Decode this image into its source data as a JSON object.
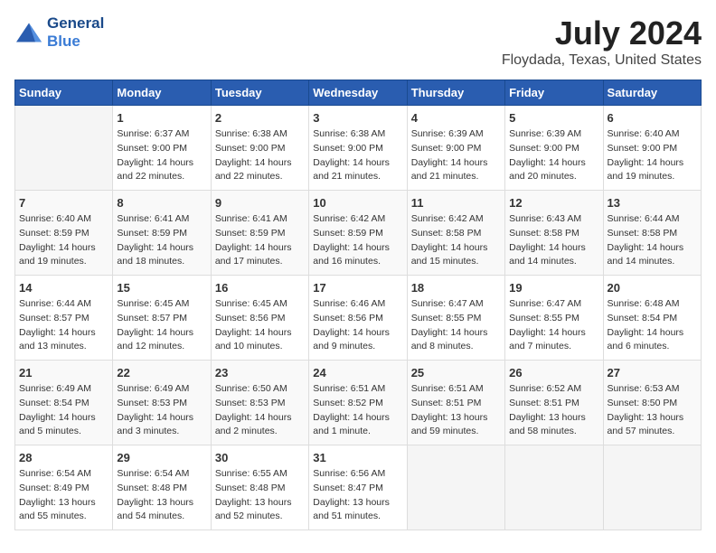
{
  "header": {
    "logo_line1": "General",
    "logo_line2": "Blue",
    "month_year": "July 2024",
    "location": "Floydada, Texas, United States"
  },
  "columns": [
    "Sunday",
    "Monday",
    "Tuesday",
    "Wednesday",
    "Thursday",
    "Friday",
    "Saturday"
  ],
  "weeks": [
    [
      {
        "day": "",
        "info": ""
      },
      {
        "day": "1",
        "info": "Sunrise: 6:37 AM\nSunset: 9:00 PM\nDaylight: 14 hours\nand 22 minutes."
      },
      {
        "day": "2",
        "info": "Sunrise: 6:38 AM\nSunset: 9:00 PM\nDaylight: 14 hours\nand 22 minutes."
      },
      {
        "day": "3",
        "info": "Sunrise: 6:38 AM\nSunset: 9:00 PM\nDaylight: 14 hours\nand 21 minutes."
      },
      {
        "day": "4",
        "info": "Sunrise: 6:39 AM\nSunset: 9:00 PM\nDaylight: 14 hours\nand 21 minutes."
      },
      {
        "day": "5",
        "info": "Sunrise: 6:39 AM\nSunset: 9:00 PM\nDaylight: 14 hours\nand 20 minutes."
      },
      {
        "day": "6",
        "info": "Sunrise: 6:40 AM\nSunset: 9:00 PM\nDaylight: 14 hours\nand 19 minutes."
      }
    ],
    [
      {
        "day": "7",
        "info": "Sunrise: 6:40 AM\nSunset: 8:59 PM\nDaylight: 14 hours\nand 19 minutes."
      },
      {
        "day": "8",
        "info": "Sunrise: 6:41 AM\nSunset: 8:59 PM\nDaylight: 14 hours\nand 18 minutes."
      },
      {
        "day": "9",
        "info": "Sunrise: 6:41 AM\nSunset: 8:59 PM\nDaylight: 14 hours\nand 17 minutes."
      },
      {
        "day": "10",
        "info": "Sunrise: 6:42 AM\nSunset: 8:59 PM\nDaylight: 14 hours\nand 16 minutes."
      },
      {
        "day": "11",
        "info": "Sunrise: 6:42 AM\nSunset: 8:58 PM\nDaylight: 14 hours\nand 15 minutes."
      },
      {
        "day": "12",
        "info": "Sunrise: 6:43 AM\nSunset: 8:58 PM\nDaylight: 14 hours\nand 14 minutes."
      },
      {
        "day": "13",
        "info": "Sunrise: 6:44 AM\nSunset: 8:58 PM\nDaylight: 14 hours\nand 14 minutes."
      }
    ],
    [
      {
        "day": "14",
        "info": "Sunrise: 6:44 AM\nSunset: 8:57 PM\nDaylight: 14 hours\nand 13 minutes."
      },
      {
        "day": "15",
        "info": "Sunrise: 6:45 AM\nSunset: 8:57 PM\nDaylight: 14 hours\nand 12 minutes."
      },
      {
        "day": "16",
        "info": "Sunrise: 6:45 AM\nSunset: 8:56 PM\nDaylight: 14 hours\nand 10 minutes."
      },
      {
        "day": "17",
        "info": "Sunrise: 6:46 AM\nSunset: 8:56 PM\nDaylight: 14 hours\nand 9 minutes."
      },
      {
        "day": "18",
        "info": "Sunrise: 6:47 AM\nSunset: 8:55 PM\nDaylight: 14 hours\nand 8 minutes."
      },
      {
        "day": "19",
        "info": "Sunrise: 6:47 AM\nSunset: 8:55 PM\nDaylight: 14 hours\nand 7 minutes."
      },
      {
        "day": "20",
        "info": "Sunrise: 6:48 AM\nSunset: 8:54 PM\nDaylight: 14 hours\nand 6 minutes."
      }
    ],
    [
      {
        "day": "21",
        "info": "Sunrise: 6:49 AM\nSunset: 8:54 PM\nDaylight: 14 hours\nand 5 minutes."
      },
      {
        "day": "22",
        "info": "Sunrise: 6:49 AM\nSunset: 8:53 PM\nDaylight: 14 hours\nand 3 minutes."
      },
      {
        "day": "23",
        "info": "Sunrise: 6:50 AM\nSunset: 8:53 PM\nDaylight: 14 hours\nand 2 minutes."
      },
      {
        "day": "24",
        "info": "Sunrise: 6:51 AM\nSunset: 8:52 PM\nDaylight: 14 hours\nand 1 minute."
      },
      {
        "day": "25",
        "info": "Sunrise: 6:51 AM\nSunset: 8:51 PM\nDaylight: 13 hours\nand 59 minutes."
      },
      {
        "day": "26",
        "info": "Sunrise: 6:52 AM\nSunset: 8:51 PM\nDaylight: 13 hours\nand 58 minutes."
      },
      {
        "day": "27",
        "info": "Sunrise: 6:53 AM\nSunset: 8:50 PM\nDaylight: 13 hours\nand 57 minutes."
      }
    ],
    [
      {
        "day": "28",
        "info": "Sunrise: 6:54 AM\nSunset: 8:49 PM\nDaylight: 13 hours\nand 55 minutes."
      },
      {
        "day": "29",
        "info": "Sunrise: 6:54 AM\nSunset: 8:48 PM\nDaylight: 13 hours\nand 54 minutes."
      },
      {
        "day": "30",
        "info": "Sunrise: 6:55 AM\nSunset: 8:48 PM\nDaylight: 13 hours\nand 52 minutes."
      },
      {
        "day": "31",
        "info": "Sunrise: 6:56 AM\nSunset: 8:47 PM\nDaylight: 13 hours\nand 51 minutes."
      },
      {
        "day": "",
        "info": ""
      },
      {
        "day": "",
        "info": ""
      },
      {
        "day": "",
        "info": ""
      }
    ]
  ]
}
